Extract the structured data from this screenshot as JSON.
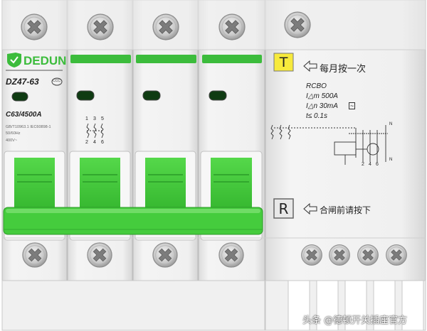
{
  "brand": {
    "name": "DEDUN",
    "color": "#3cbc3c"
  },
  "mcb": {
    "model": "DZ47-63",
    "rating": "C63/4500A",
    "standards": "GB/T10963.1  IEC60898-1",
    "frequency": "50/60Hz",
    "voltage": "400V~",
    "terminal_labels": [
      "1",
      "3",
      "5",
      "2",
      "4",
      "6"
    ],
    "cert_mark": "CCC"
  },
  "rcbo": {
    "label": "RCBO",
    "rated_current": "I△m  500A",
    "rated_residual": "I△n  30mA",
    "trip_time": "t≤ 0.1s",
    "tn_labels": [
      "N",
      "N"
    ],
    "out_labels": [
      "2",
      "4",
      "6"
    ]
  },
  "test_button": {
    "key": "T",
    "hint": "每月按一次",
    "color": "#f7ea3c"
  },
  "reset_button": {
    "key": "R",
    "hint": "合闸前请按下"
  },
  "watermark": "头条 @德顿开关插座官方",
  "colors": {
    "body": "#eeeeee",
    "handle": "#3ec43a",
    "handle_dark": "#2aa12a",
    "window": "#0f3b12"
  }
}
